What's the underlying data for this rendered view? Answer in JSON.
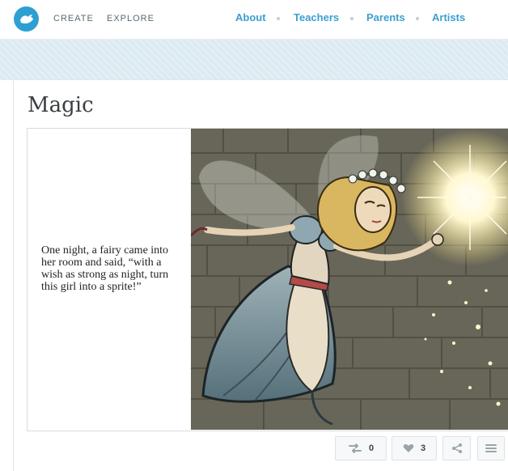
{
  "nav": {
    "create": "CREATE",
    "explore": "EXPLORE",
    "about": "About",
    "teachers": "Teachers",
    "parents": "Parents",
    "artists": "Artists"
  },
  "book": {
    "title": "Magic",
    "page_text": "One night, a fairy came into her room and said, “with a wish as strong as night, turn this girl into a sprite!”"
  },
  "actions": {
    "remix_count": "0",
    "like_count": "3"
  },
  "icons": [
    "bird-logo-icon",
    "remix-icon",
    "heart-icon",
    "share-icon",
    "menu-icon"
  ],
  "colors": {
    "brand_blue": "#2e9fd3",
    "link_blue": "#3ba0cf",
    "band": "#dcebf1"
  }
}
